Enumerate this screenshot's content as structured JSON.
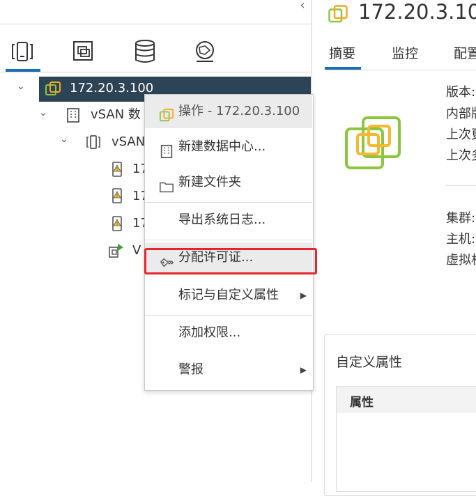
{
  "nav": {
    "collapse_glyph": "‹",
    "tabs": [
      {
        "name": "hosts-and-clusters-tab",
        "icon": "hosts-clusters-icon",
        "active": true
      },
      {
        "name": "vms-and-templates-tab",
        "icon": "vms-templates-icon",
        "active": false
      },
      {
        "name": "storage-tab",
        "icon": "database-icon",
        "active": false
      },
      {
        "name": "networking-tab",
        "icon": "network-icon",
        "active": false
      }
    ],
    "tree": {
      "root": "172.20.3.100",
      "datacenter": "vSAN 数",
      "cluster": "vSAN",
      "hosts": [
        "17",
        "17",
        "17"
      ],
      "vm": "V"
    }
  },
  "right": {
    "title": "172.20.3.10",
    "tabs": [
      "摘要",
      "监控",
      "配置"
    ],
    "labels_top": [
      "版本:",
      "内部版",
      "上次更",
      "上次多"
    ],
    "labels_mid": [
      "集群:",
      "主机:",
      "虚拟机"
    ],
    "attributes": {
      "title": "自定义属性",
      "column": "属性"
    }
  },
  "context_menu": {
    "header": "操作 - 172.20.3.100",
    "items": {
      "new_datacenter": "新建数据中心...",
      "new_folder": "新建文件夹",
      "export_logs": "导出系统日志...",
      "assign_license": "分配许可证...",
      "tags_attributes": "标记与自定义属性",
      "add_permission": "添加权限...",
      "alarms": "警报"
    },
    "submenu_arrow": "▶"
  },
  "colors": {
    "accent": "#1b6eb2",
    "selected_row": "#2d4456",
    "highlight_box": "#e8232e",
    "vcenter_green": "#8cc63f",
    "vcenter_orange": "#f5a623"
  }
}
